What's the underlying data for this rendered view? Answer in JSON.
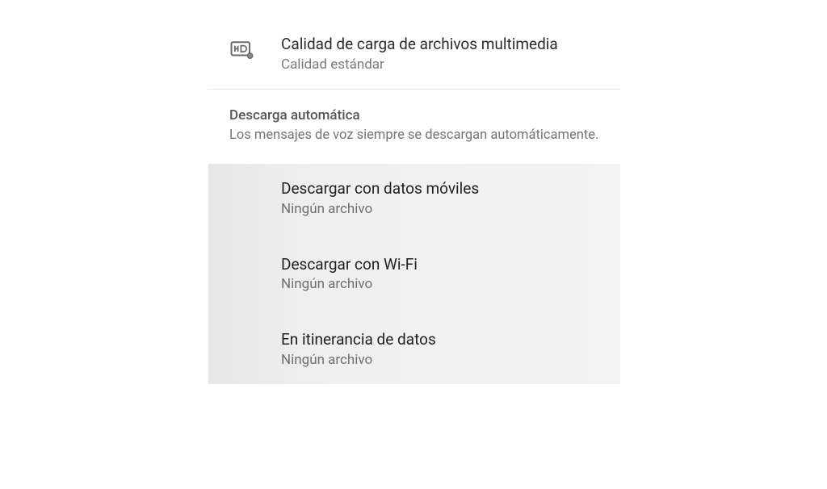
{
  "upload": {
    "title": "Calidad de carga de archivos multimedia",
    "subtitle": "Calidad estándar"
  },
  "auto_download": {
    "header": "Descarga automática",
    "desc": "Los mensajes de voz siempre se descargan automáticamente.",
    "items": [
      {
        "title": "Descargar con datos móviles",
        "sub": "Ningún archivo"
      },
      {
        "title": "Descargar con Wi-Fi",
        "sub": "Ningún archivo"
      },
      {
        "title": "En itinerancia de datos",
        "sub": "Ningún archivo"
      }
    ]
  }
}
